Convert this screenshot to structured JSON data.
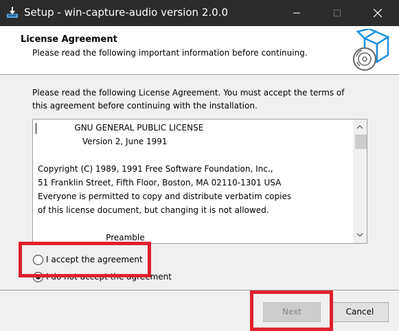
{
  "window": {
    "title": "Setup - win-capture-audio version 2.0.0"
  },
  "titlebar_controls": {
    "minimize": "minimize-icon",
    "maximize": "maximize-icon",
    "close": "close-icon"
  },
  "header": {
    "title": "License Agreement",
    "subtitle": "Please read the following important information before continuing."
  },
  "instructions": "Please read the following License Agreement. You must accept the terms of this agreement before continuing with the installation.",
  "license_lines": [
    "              GNU GENERAL PUBLIC LICENSE",
    "                 Version 2, June 1991",
    "",
    "Copyright (C) 1989, 1991 Free Software Foundation, Inc.,",
    "51 Franklin Street, Fifth Floor, Boston, MA 02110-1301 USA",
    "Everyone is permitted to copy and distribute verbatim copies",
    "of this license document, but changing it is not allowed.",
    "",
    "                          Preamble"
  ],
  "options": {
    "accept_label": "I accept the agreement",
    "decline_label": "I do not accept the agreement",
    "selected": "decline"
  },
  "buttons": {
    "next_label": "Next",
    "cancel_label": "Cancel"
  },
  "colors": {
    "titlebar": "#2b2b2b",
    "highlight": "#e0202e",
    "accent": "#1e90e0"
  }
}
